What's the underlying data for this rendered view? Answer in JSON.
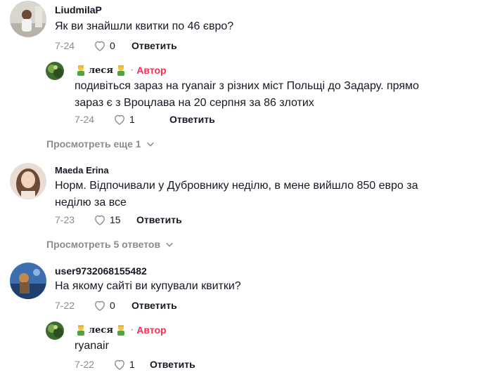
{
  "comments": [
    {
      "user": "LiudmilaP",
      "text": "Як ви знайшли квитки по 46 євро?",
      "date": "7-24",
      "likes": "0",
      "reply_label": "Ответить",
      "reply": {
        "user": "леся",
        "author_label": "Автор",
        "text_line1": "подивіться зараз на ryanair з різних міст Польщі до Задару. прямо",
        "text_line2": "зараз є з Вроцлава на 20 серпня за 86 злотих",
        "date": "7-24",
        "likes": "1",
        "reply_label": "Ответить"
      },
      "view_more": "Просмотреть еще 1"
    },
    {
      "user": "Maeda Erina",
      "text_line1": "Норм. Відпочивали у Дубровнику неділю, в мене вийшло 850 евро за",
      "text_line2": "неділю за все",
      "date": "7-23",
      "likes": "15",
      "reply_label": "Ответить",
      "view_more": "Просмотреть 5 ответов"
    },
    {
      "user": "user9732068155482",
      "text": "На якому сайті ви купували квитки?",
      "date": "7-22",
      "likes": "0",
      "reply_label": "Ответить",
      "reply": {
        "user": "леся",
        "author_label": "Автор",
        "text": "ryanair",
        "date": "7-22",
        "likes": "1",
        "reply_label": "Ответить"
      }
    }
  ],
  "dot": "·",
  "colors": {
    "author": "#fe2c55",
    "muted": "#8a8b91",
    "text": "#161823"
  },
  "icons": {
    "like": "heart-outline-icon",
    "more": "chevron-down-icon",
    "emoji": "person-emoji-icon"
  }
}
